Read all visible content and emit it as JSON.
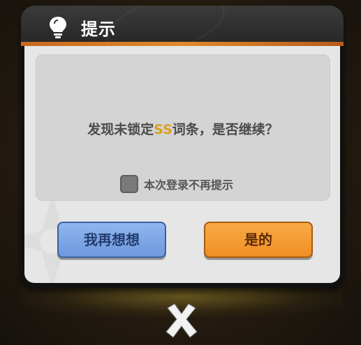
{
  "dialog": {
    "title": "提示",
    "message_before": "发现未锁定",
    "message_highlight": "SS",
    "message_after": "词条，是否继续？",
    "checkbox_label": "本次登录不再提示",
    "checkbox_checked": false,
    "cancel_label": "我再想想",
    "confirm_label": "是的"
  },
  "icons": {
    "title_icon": "lightbulb-icon",
    "close_icon": "close-icon"
  },
  "colors": {
    "accent_orange": "#ef8f25",
    "cancel_blue": "#6f98de",
    "highlight_gold": "#d9a21c"
  }
}
